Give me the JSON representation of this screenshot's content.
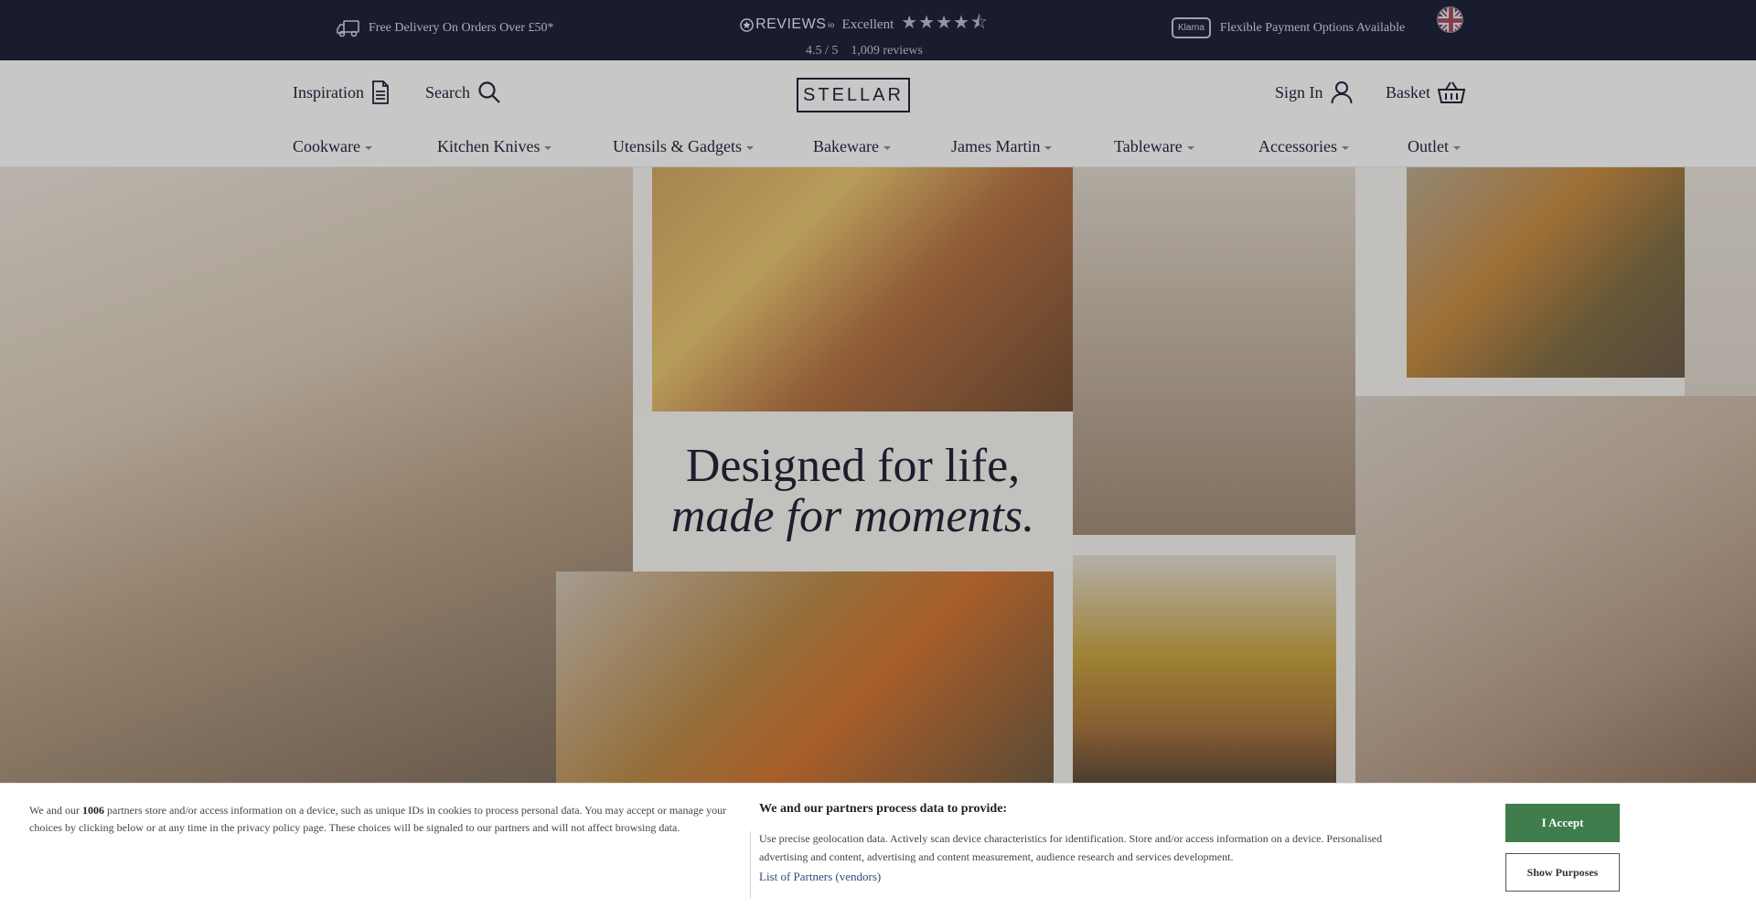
{
  "topbar": {
    "delivery_text": "Free Delivery On Orders Over £50*",
    "reviews_logo": "REVIEWS",
    "reviews_logo_suffix": "io",
    "reviews_rating_word": "Excellent",
    "reviews_stars": "★★★★⯪",
    "reviews_score": "4.5 / 5",
    "reviews_count": "1,009 reviews",
    "klarna_badge": "Klarna",
    "payment_text": "Flexible Payment Options Available"
  },
  "header": {
    "inspiration_label": "Inspiration",
    "search_label": "Search",
    "logo_text": "STELLAR",
    "signin_label": "Sign In",
    "basket_label": "Basket"
  },
  "nav": {
    "items": [
      {
        "label": "Cookware"
      },
      {
        "label": "Kitchen Knives"
      },
      {
        "label": "Utensils & Gadgets"
      },
      {
        "label": "Bakeware"
      },
      {
        "label": "James Martin"
      },
      {
        "label": "Tableware"
      },
      {
        "label": "Accessories"
      },
      {
        "label": "Outlet"
      }
    ]
  },
  "hero": {
    "tagline_line1": "Designed for life,",
    "tagline_line2": "made for moments."
  },
  "cookie": {
    "left_prefix": "We and our ",
    "partner_count": "1006",
    "left_suffix": " partners store and/or access information on a device, such as unique IDs in cookies to process personal data. You may accept or manage your choices by clicking below or at any time in the privacy policy page. These choices will be signaled to our partners and will not affect browsing data.",
    "title": "We and our partners process data to provide:",
    "purposes_text": "Use precise geolocation data. Actively scan device characteristics for identification. Store and/or access information on a device. Personalised advertising and content, advertising and content measurement, audience research and services development.",
    "partners_link": "List of Partners (vendors)",
    "accept_label": "I Accept",
    "purposes_label": "Show Purposes"
  },
  "colors": {
    "topbar_bg": "#1b1f36",
    "accept_green": "#3f7d4c",
    "text_dark": "#1e2233"
  }
}
